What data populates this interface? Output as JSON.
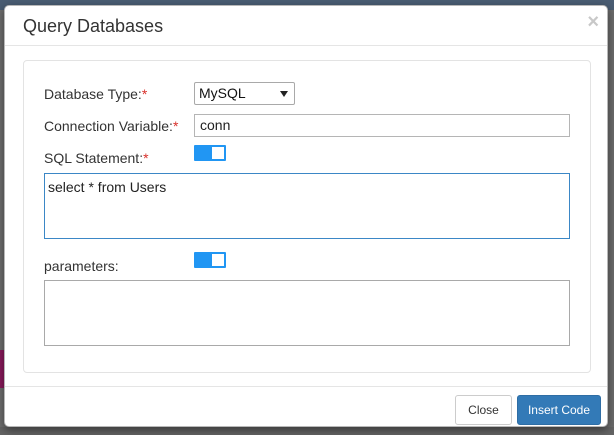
{
  "dialog": {
    "title": "Query Databases",
    "close_symbol": "×"
  },
  "form": {
    "database_type": {
      "label": "Database Type:",
      "required_mark": "*",
      "selected": "MySQL"
    },
    "connection_variable": {
      "label": "Connection Variable:",
      "required_mark": "*",
      "value": "conn"
    },
    "sql_statement": {
      "label": "SQL Statement:",
      "required_mark": "*",
      "toggle_on": true,
      "value": "select * from Users"
    },
    "parameters": {
      "label": "parameters:",
      "toggle_on": true,
      "value": ""
    }
  },
  "footer": {
    "close_label": "Close",
    "insert_label": "Insert Code"
  },
  "colors": {
    "toggle_on": "#2196f3",
    "primary_button": "#337ab7",
    "required": "#d9312b"
  }
}
